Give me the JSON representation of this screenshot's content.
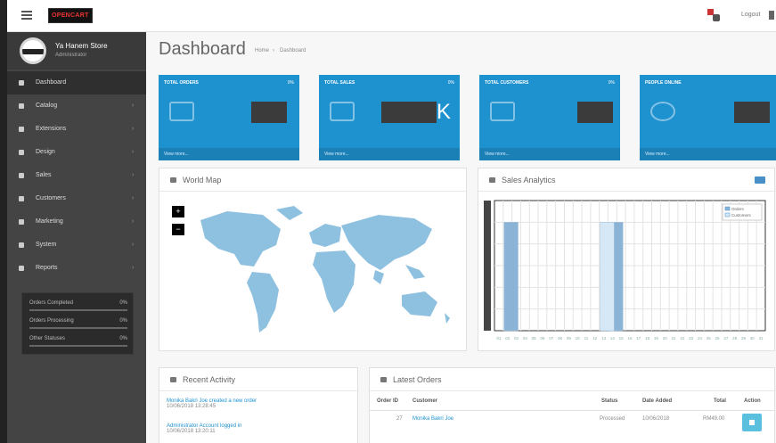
{
  "topbar": {
    "logo_text": "OPENCART",
    "logout_label": "Logout"
  },
  "sidebar": {
    "profile": {
      "name": "Ya Hanem Store",
      "role": "Administrator"
    },
    "items": [
      {
        "label": "Dashboard",
        "icon": "dashboard-icon",
        "active": true
      },
      {
        "label": "Catalog",
        "icon": "tag-icon"
      },
      {
        "label": "Extensions",
        "icon": "puzzle-icon"
      },
      {
        "label": "Design",
        "icon": "desktop-icon"
      },
      {
        "label": "Sales",
        "icon": "cart-icon"
      },
      {
        "label": "Customers",
        "icon": "user-icon"
      },
      {
        "label": "Marketing",
        "icon": "share-icon"
      },
      {
        "label": "System",
        "icon": "cog-icon"
      },
      {
        "label": "Reports",
        "icon": "bar-chart-icon"
      }
    ],
    "stats": [
      {
        "label": "Orders Completed",
        "value": "0%",
        "fill": 0
      },
      {
        "label": "Orders Processing",
        "value": "0%",
        "fill": 0
      },
      {
        "label": "Other Statuses",
        "value": "0%",
        "fill": 0
      }
    ]
  },
  "header": {
    "title": "Dashboard",
    "breadcrumb": [
      "Home",
      "Dashboard"
    ]
  },
  "tiles": [
    {
      "title": "TOTAL ORDERS",
      "percent": "0%",
      "icon": "shopping-cart-icon",
      "more": "View more..."
    },
    {
      "title": "TOTAL SALES",
      "percent": "0%",
      "icon": "credit-card-icon",
      "suffix": "K",
      "more": "View more..."
    },
    {
      "title": "TOTAL CUSTOMERS",
      "percent": "0%",
      "icon": "user-icon",
      "more": "View more..."
    },
    {
      "title": "PEOPLE ONLINE",
      "percent": "",
      "icon": "eye-icon",
      "more": "View more..."
    }
  ],
  "world_map": {
    "title": "World Map",
    "zoom_in": "+",
    "zoom_out": "−"
  },
  "sales_analytics": {
    "title": "Sales Analytics",
    "legend": [
      "Orders",
      "Customers"
    ]
  },
  "chart_data": {
    "type": "bar",
    "categories": [
      "01",
      "02",
      "03",
      "04",
      "05",
      "06",
      "07",
      "08",
      "09",
      "10",
      "11",
      "12",
      "13",
      "14",
      "15",
      "16",
      "17",
      "18",
      "19",
      "20",
      "21",
      "22",
      "23",
      "24",
      "25",
      "26",
      "27",
      "28",
      "29",
      "30",
      "31"
    ],
    "series": [
      {
        "name": "Orders",
        "values": [
          0,
          1,
          0,
          0,
          0,
          0,
          0,
          0,
          0,
          0,
          0,
          0,
          0,
          1,
          0,
          0,
          0,
          0,
          0,
          0,
          0,
          0,
          0,
          0,
          0,
          0,
          0,
          0,
          0,
          0,
          0
        ]
      },
      {
        "name": "Customers",
        "values": [
          0,
          0,
          0,
          0,
          0,
          0,
          0,
          0,
          0,
          0,
          0,
          0,
          1,
          0,
          0,
          0,
          0,
          0,
          0,
          0,
          0,
          0,
          0,
          0,
          0,
          0,
          0,
          0,
          0,
          0,
          0
        ]
      }
    ],
    "ylim": [
      0,
      1.2
    ],
    "grid": true,
    "legend_position": "top-right",
    "colors": {
      "Orders": "#8bb3d6",
      "Customers": "#d6e7f5"
    }
  },
  "recent_activity": {
    "title": "Recent Activity",
    "items": [
      {
        "text": "Monika Bakri Joe created a new order",
        "time": "10/06/2018 13:28:45"
      },
      {
        "text": "Administrator Account logged in",
        "time": "10/06/2018 13:20:11"
      }
    ]
  },
  "latest_orders": {
    "title": "Latest Orders",
    "columns": [
      "Order ID",
      "Customer",
      "Status",
      "Date Added",
      "Total",
      "Action"
    ],
    "rows": [
      {
        "id": "27",
        "customer": "Monika Bakri Joe",
        "status": "Processed",
        "date": "10/06/2018",
        "total": "RM49.00"
      }
    ]
  }
}
